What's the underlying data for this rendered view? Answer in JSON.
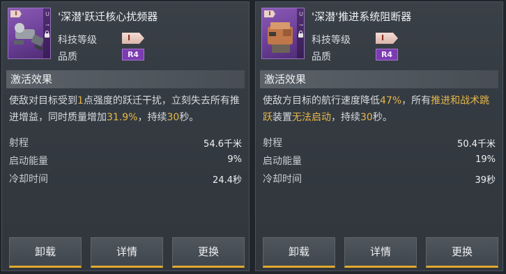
{
  "cards": [
    {
      "name": "'深潜'跃迁核心扰频器",
      "tech_label": "科技等级",
      "tech_badge": "I",
      "quality_label": "品质",
      "quality_badge": "R4",
      "thumb_tier": "I",
      "thumb_side_u": "U",
      "thumb_side_glyph": "⊸",
      "section_title": "激活效果",
      "desc": [
        {
          "t": "使敌对目标受到",
          "h": false
        },
        {
          "t": "1",
          "h": true
        },
        {
          "t": "点强度的跃迁干扰，立刻失去所有推进增益，同时质量增加",
          "h": false
        },
        {
          "t": "31.9%",
          "h": true
        },
        {
          "t": "，持续",
          "h": false
        },
        {
          "t": "30",
          "h": true
        },
        {
          "t": "秒。",
          "h": false
        }
      ],
      "stats": [
        {
          "label": "射程",
          "value": "54.6千米"
        },
        {
          "label": "启动能量",
          "value": "9%"
        },
        {
          "label": "冷却时间",
          "value": "24.4秒"
        }
      ],
      "buttons": [
        "卸载",
        "详情",
        "更换"
      ]
    },
    {
      "name": "'深潜'推进系统阻断器",
      "tech_label": "科技等级",
      "tech_badge": "I",
      "quality_label": "品质",
      "quality_badge": "R4",
      "thumb_tier": "I",
      "thumb_side_u": "U",
      "thumb_side_glyph": "⊸",
      "section_title": "激活效果",
      "desc": [
        {
          "t": "使敌方目标的航行速度降低",
          "h": false
        },
        {
          "t": "47%",
          "h": true
        },
        {
          "t": "，所有",
          "h": false
        },
        {
          "t": "推进和战术跳跃",
          "h": true
        },
        {
          "t": "装置",
          "h": false
        },
        {
          "t": "无法启动",
          "h": true
        },
        {
          "t": "，持续",
          "h": false
        },
        {
          "t": "30",
          "h": true
        },
        {
          "t": "秒。",
          "h": false
        }
      ],
      "stats": [
        {
          "label": "射程",
          "value": "50.4千米"
        },
        {
          "label": "启动能量",
          "value": "19%"
        },
        {
          "label": "冷却时间",
          "value": "39秒"
        }
      ],
      "buttons": [
        "卸载",
        "详情",
        "更换"
      ]
    }
  ],
  "colors": {
    "highlight": "#e6b84a",
    "button_accent": "#e2a92f",
    "quality": "#7b3cb0"
  }
}
